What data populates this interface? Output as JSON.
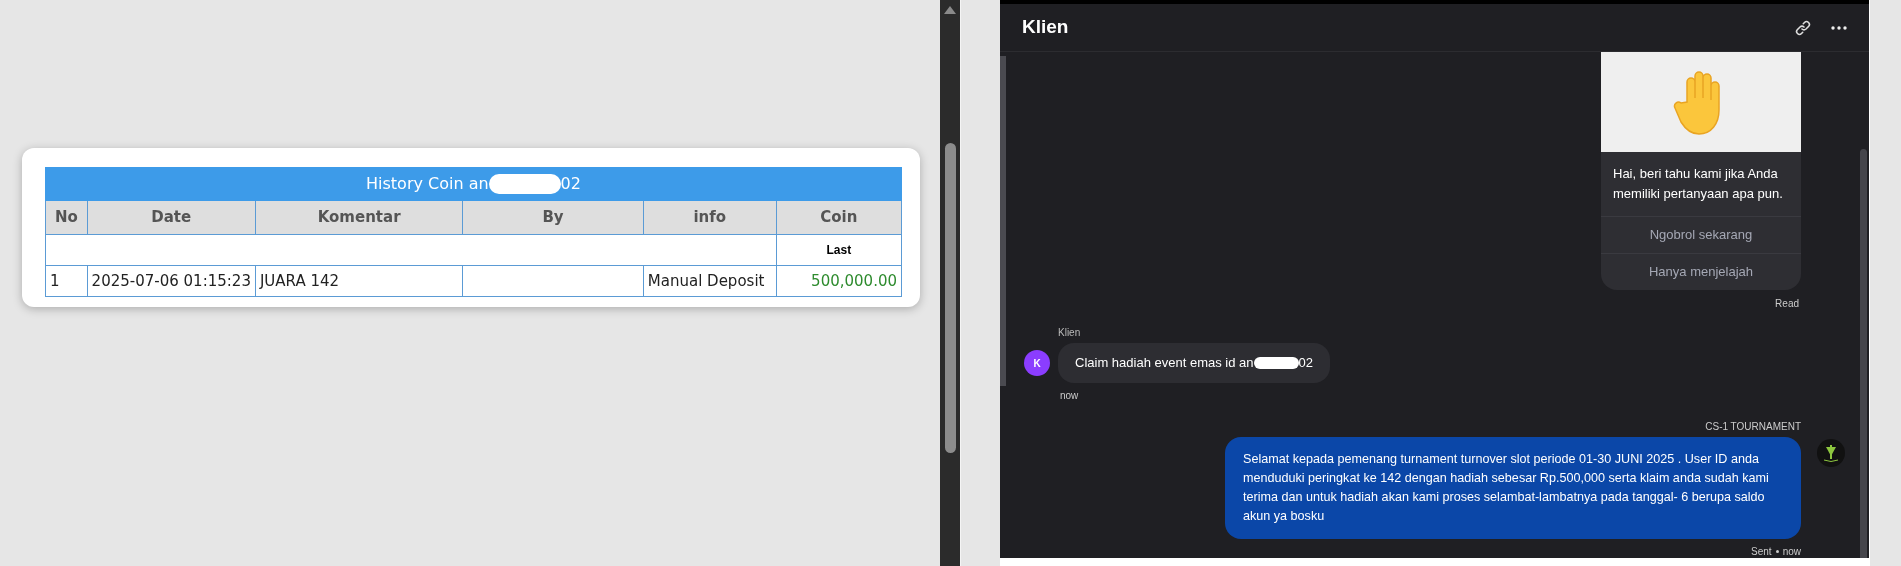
{
  "history_table": {
    "title": [
      "History Coin an",
      "02"
    ],
    "columns": [
      "No",
      "Date",
      "Komentar",
      "By",
      "info",
      "Coin"
    ],
    "subheader": "Last",
    "rows": [
      {
        "no": "1",
        "date": "2025-07-06 01:15:23",
        "komentar": "JUARA 142",
        "info": "Manual Deposit",
        "coin": "500,000.00"
      }
    ]
  },
  "chat": {
    "header": {
      "title": "Klien"
    },
    "messages": [
      {
        "kind": "card",
        "text": "Hai, beri tahu kami jika Anda memiliki pertanyaan apa pun.",
        "options": [
          "Ngobrol sekarang",
          "Hanya menjelajah"
        ],
        "status": "Read"
      },
      {
        "kind": "incoming",
        "sender": "Klien",
        "avatar": "K",
        "text": [
          "Claim hadiah event emas id an",
          "02"
        ],
        "time": "now"
      },
      {
        "kind": "outgoing",
        "sender": "CS-1 TOURNAMENT",
        "text": "Selamat kepada pemenang turnament turnover slot periode 01-30 JUNI 2025 . User ID anda menduduki peringkat ke 142 dengan hadiah sebesar Rp.500,000 serta klaim anda sudah kami terima dan untuk hadiah akan kami proses selambat-lambatnya pada tanggal- 6 berupa saldo akun ya bosku",
        "status": "Sent",
        "time": "now"
      }
    ]
  }
}
